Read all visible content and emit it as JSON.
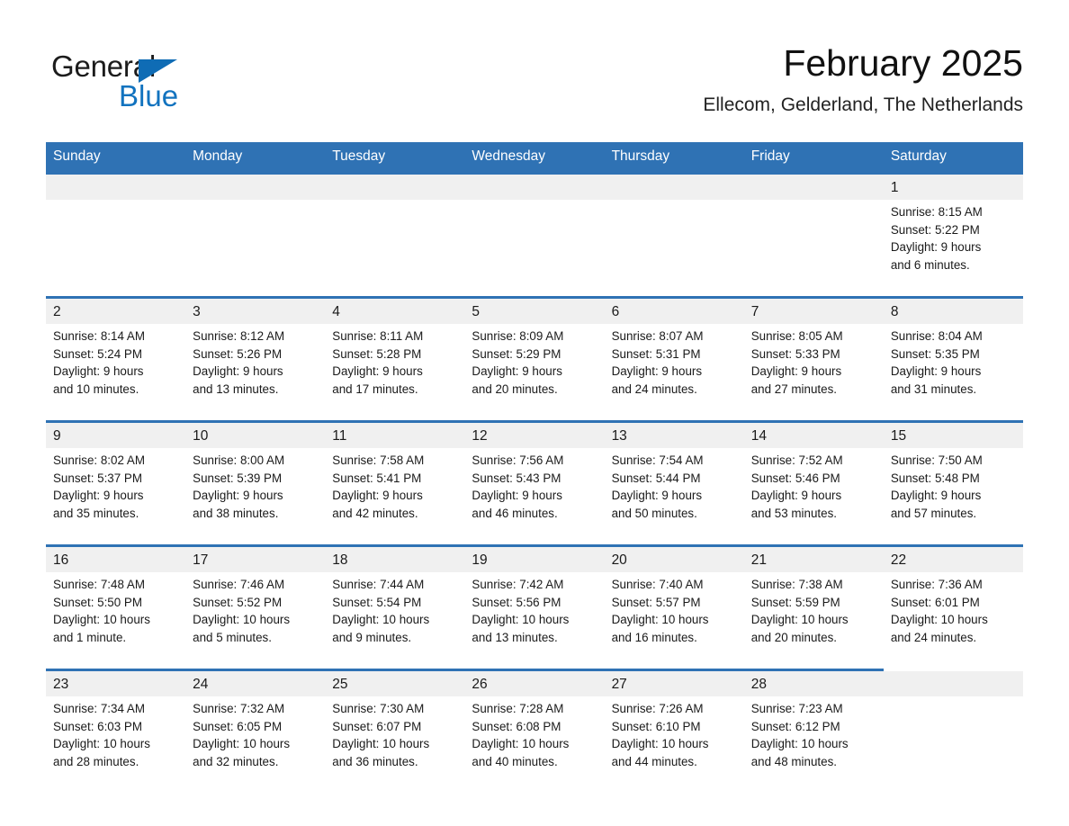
{
  "brand": {
    "logo_text_primary": "General",
    "logo_text_secondary": "Blue",
    "accent_color": "#2f72b4",
    "logo_blue": "#1273bf"
  },
  "header": {
    "title": "February 2025",
    "subtitle": "Ellecom, Gelderland, The Netherlands"
  },
  "calendar": {
    "weekday_headers": [
      "Sunday",
      "Monday",
      "Tuesday",
      "Wednesday",
      "Thursday",
      "Friday",
      "Saturday"
    ],
    "weeks": [
      [
        {
          "day": "",
          "empty": true
        },
        {
          "day": "",
          "empty": true
        },
        {
          "day": "",
          "empty": true
        },
        {
          "day": "",
          "empty": true
        },
        {
          "day": "",
          "empty": true
        },
        {
          "day": "",
          "empty": true
        },
        {
          "day": "1",
          "sunrise": "Sunrise: 8:15 AM",
          "sunset": "Sunset: 5:22 PM",
          "daylight_line1": "Daylight: 9 hours",
          "daylight_line2": "and 6 minutes."
        }
      ],
      [
        {
          "day": "2",
          "sunrise": "Sunrise: 8:14 AM",
          "sunset": "Sunset: 5:24 PM",
          "daylight_line1": "Daylight: 9 hours",
          "daylight_line2": "and 10 minutes."
        },
        {
          "day": "3",
          "sunrise": "Sunrise: 8:12 AM",
          "sunset": "Sunset: 5:26 PM",
          "daylight_line1": "Daylight: 9 hours",
          "daylight_line2": "and 13 minutes."
        },
        {
          "day": "4",
          "sunrise": "Sunrise: 8:11 AM",
          "sunset": "Sunset: 5:28 PM",
          "daylight_line1": "Daylight: 9 hours",
          "daylight_line2": "and 17 minutes."
        },
        {
          "day": "5",
          "sunrise": "Sunrise: 8:09 AM",
          "sunset": "Sunset: 5:29 PM",
          "daylight_line1": "Daylight: 9 hours",
          "daylight_line2": "and 20 minutes."
        },
        {
          "day": "6",
          "sunrise": "Sunrise: 8:07 AM",
          "sunset": "Sunset: 5:31 PM",
          "daylight_line1": "Daylight: 9 hours",
          "daylight_line2": "and 24 minutes."
        },
        {
          "day": "7",
          "sunrise": "Sunrise: 8:05 AM",
          "sunset": "Sunset: 5:33 PM",
          "daylight_line1": "Daylight: 9 hours",
          "daylight_line2": "and 27 minutes."
        },
        {
          "day": "8",
          "sunrise": "Sunrise: 8:04 AM",
          "sunset": "Sunset: 5:35 PM",
          "daylight_line1": "Daylight: 9 hours",
          "daylight_line2": "and 31 minutes."
        }
      ],
      [
        {
          "day": "9",
          "sunrise": "Sunrise: 8:02 AM",
          "sunset": "Sunset: 5:37 PM",
          "daylight_line1": "Daylight: 9 hours",
          "daylight_line2": "and 35 minutes."
        },
        {
          "day": "10",
          "sunrise": "Sunrise: 8:00 AM",
          "sunset": "Sunset: 5:39 PM",
          "daylight_line1": "Daylight: 9 hours",
          "daylight_line2": "and 38 minutes."
        },
        {
          "day": "11",
          "sunrise": "Sunrise: 7:58 AM",
          "sunset": "Sunset: 5:41 PM",
          "daylight_line1": "Daylight: 9 hours",
          "daylight_line2": "and 42 minutes."
        },
        {
          "day": "12",
          "sunrise": "Sunrise: 7:56 AM",
          "sunset": "Sunset: 5:43 PM",
          "daylight_line1": "Daylight: 9 hours",
          "daylight_line2": "and 46 minutes."
        },
        {
          "day": "13",
          "sunrise": "Sunrise: 7:54 AM",
          "sunset": "Sunset: 5:44 PM",
          "daylight_line1": "Daylight: 9 hours",
          "daylight_line2": "and 50 minutes."
        },
        {
          "day": "14",
          "sunrise": "Sunrise: 7:52 AM",
          "sunset": "Sunset: 5:46 PM",
          "daylight_line1": "Daylight: 9 hours",
          "daylight_line2": "and 53 minutes."
        },
        {
          "day": "15",
          "sunrise": "Sunrise: 7:50 AM",
          "sunset": "Sunset: 5:48 PM",
          "daylight_line1": "Daylight: 9 hours",
          "daylight_line2": "and 57 minutes."
        }
      ],
      [
        {
          "day": "16",
          "sunrise": "Sunrise: 7:48 AM",
          "sunset": "Sunset: 5:50 PM",
          "daylight_line1": "Daylight: 10 hours",
          "daylight_line2": "and 1 minute."
        },
        {
          "day": "17",
          "sunrise": "Sunrise: 7:46 AM",
          "sunset": "Sunset: 5:52 PM",
          "daylight_line1": "Daylight: 10 hours",
          "daylight_line2": "and 5 minutes."
        },
        {
          "day": "18",
          "sunrise": "Sunrise: 7:44 AM",
          "sunset": "Sunset: 5:54 PM",
          "daylight_line1": "Daylight: 10 hours",
          "daylight_line2": "and 9 minutes."
        },
        {
          "day": "19",
          "sunrise": "Sunrise: 7:42 AM",
          "sunset": "Sunset: 5:56 PM",
          "daylight_line1": "Daylight: 10 hours",
          "daylight_line2": "and 13 minutes."
        },
        {
          "day": "20",
          "sunrise": "Sunrise: 7:40 AM",
          "sunset": "Sunset: 5:57 PM",
          "daylight_line1": "Daylight: 10 hours",
          "daylight_line2": "and 16 minutes."
        },
        {
          "day": "21",
          "sunrise": "Sunrise: 7:38 AM",
          "sunset": "Sunset: 5:59 PM",
          "daylight_line1": "Daylight: 10 hours",
          "daylight_line2": "and 20 minutes."
        },
        {
          "day": "22",
          "sunrise": "Sunrise: 7:36 AM",
          "sunset": "Sunset: 6:01 PM",
          "daylight_line1": "Daylight: 10 hours",
          "daylight_line2": "and 24 minutes."
        }
      ],
      [
        {
          "day": "23",
          "sunrise": "Sunrise: 7:34 AM",
          "sunset": "Sunset: 6:03 PM",
          "daylight_line1": "Daylight: 10 hours",
          "daylight_line2": "and 28 minutes."
        },
        {
          "day": "24",
          "sunrise": "Sunrise: 7:32 AM",
          "sunset": "Sunset: 6:05 PM",
          "daylight_line1": "Daylight: 10 hours",
          "daylight_line2": "and 32 minutes."
        },
        {
          "day": "25",
          "sunrise": "Sunrise: 7:30 AM",
          "sunset": "Sunset: 6:07 PM",
          "daylight_line1": "Daylight: 10 hours",
          "daylight_line2": "and 36 minutes."
        },
        {
          "day": "26",
          "sunrise": "Sunrise: 7:28 AM",
          "sunset": "Sunset: 6:08 PM",
          "daylight_line1": "Daylight: 10 hours",
          "daylight_line2": "and 40 minutes."
        },
        {
          "day": "27",
          "sunrise": "Sunrise: 7:26 AM",
          "sunset": "Sunset: 6:10 PM",
          "daylight_line1": "Daylight: 10 hours",
          "daylight_line2": "and 44 minutes."
        },
        {
          "day": "28",
          "sunrise": "Sunrise: 7:23 AM",
          "sunset": "Sunset: 6:12 PM",
          "daylight_line1": "Daylight: 10 hours",
          "daylight_line2": "and 48 minutes."
        },
        {
          "day": "",
          "empty": true,
          "no_rule": true
        }
      ]
    ]
  }
}
